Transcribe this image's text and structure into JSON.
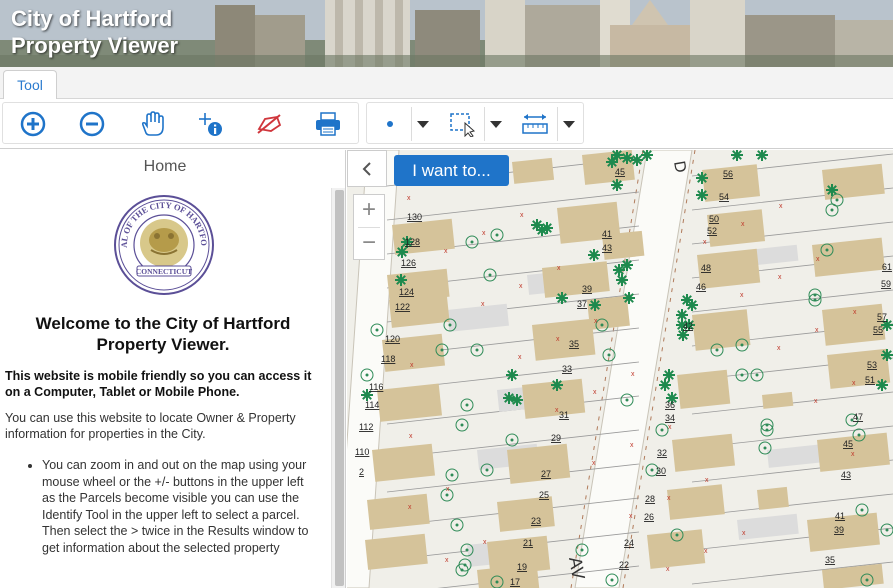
{
  "app": {
    "title_line1": "City of Hartford",
    "title_line2": "Property Viewer"
  },
  "tabs": [
    {
      "label": "Tool",
      "active": true
    }
  ],
  "toolbar": {
    "buttons": [
      {
        "icon": "zoom-in-icon"
      },
      {
        "icon": "zoom-out-icon"
      },
      {
        "icon": "pan-hand-icon"
      },
      {
        "icon": "identify-icon"
      },
      {
        "icon": "clear-graphics-icon"
      },
      {
        "icon": "print-icon"
      },
      {
        "icon": "point-select-icon"
      },
      {
        "icon": "rectangle-select-icon"
      },
      {
        "icon": "measure-icon"
      }
    ],
    "accent": "#1f74c9"
  },
  "panel": {
    "heading": "Home",
    "seal": {
      "outer_text": "SEAL OF THE CITY OF HARTFORD",
      "bottom_text": "CONNECTICUT"
    },
    "welcome": "Welcome to the City of Hartford Property Viewer.",
    "intro_bold": "This website is mobile friendly so you can access it on a Computer, Tablet or Mobile Phone.",
    "intro": "You can use this website to locate Owner & Property information for properties in the City.",
    "bullets": [
      "You can zoom in and out on the map using your mouse wheel or the +/- buttons in the upper left as the Parcels become visible you can use the Identify Tool in the upper left to select a parcel. Then select the > twice in the Results window to get information about the selected property"
    ]
  },
  "map": {
    "i_want_label": "I want to...",
    "collapse_glyph": "‹",
    "zoom_in_glyph": "+",
    "zoom_out_glyph": "−",
    "street_label_1": "D",
    "street_label_2": "AV",
    "parcel_numbers": [
      "130",
      "128",
      "126",
      "124",
      "122",
      "120",
      "118",
      "116",
      "114",
      "112",
      "110",
      "2",
      "45",
      "41",
      "43",
      "39",
      "37",
      "35",
      "33",
      "31",
      "29",
      "27",
      "25",
      "23",
      "21",
      "19",
      "17",
      "56",
      "54",
      "50",
      "52",
      "48",
      "46",
      "42",
      "36",
      "34",
      "32",
      "30",
      "28",
      "26",
      "24",
      "22",
      "61",
      "59",
      "57",
      "55",
      "53",
      "51",
      "47",
      "45",
      "43",
      "41",
      "39",
      "35"
    ],
    "colors": {
      "building": "#d5c39a",
      "pavement": "#dcdcdc",
      "ground": "#f0efe9",
      "tree": "#1e8a4e",
      "road_line": "#b07a5a"
    }
  }
}
